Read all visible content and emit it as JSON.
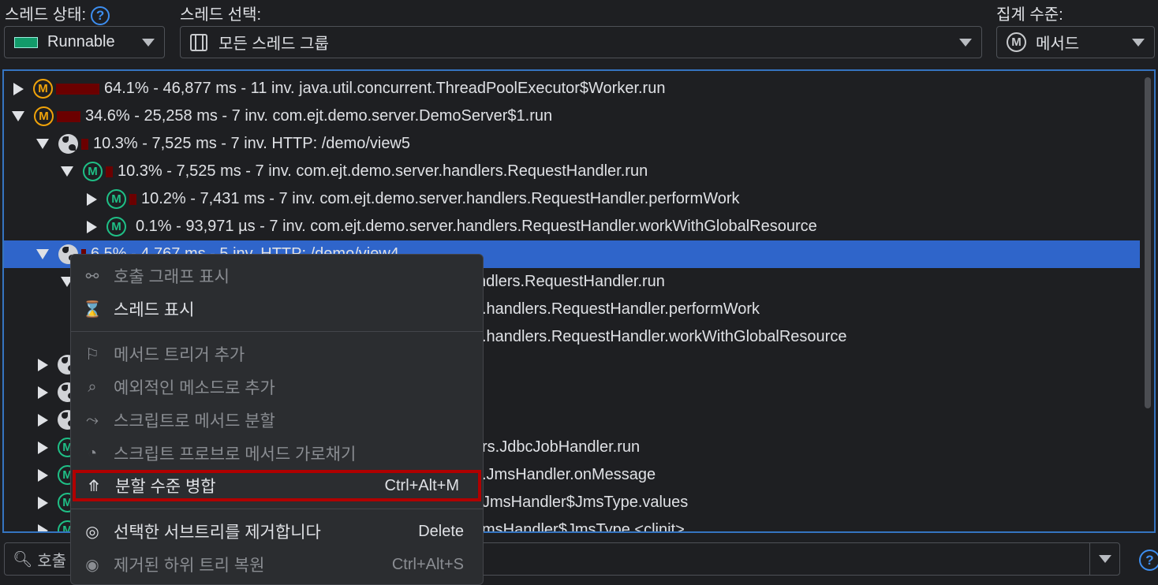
{
  "header": {
    "thread_state_label": "스레드 상태:",
    "thread_select_label": "스레드 선택:",
    "aggregation_label": "집계 수준:",
    "thread_state_value": "Runnable",
    "thread_state_color": "#129b6a",
    "thread_group_value": "모든 스레드 그룹",
    "aggregation_value": "메서드",
    "aggregation_icon": "M"
  },
  "tree": {
    "rows": [
      {
        "level": 0,
        "state": "collapsed",
        "icon": "method-orange",
        "bar_percent": 64.1,
        "text": "64.1% - 46,877 ms - 11 inv. java.util.concurrent.ThreadPoolExecutor$Worker.run"
      },
      {
        "level": 0,
        "state": "expanded",
        "icon": "method-orange",
        "bar_percent": 34.6,
        "text": "34.6% - 25,258 ms - 7 inv. com.ejt.demo.server.DemoServer$1.run"
      },
      {
        "level": 1,
        "state": "expanded",
        "icon": "globe",
        "bar_percent": 10.3,
        "text": "10.3% - 7,525 ms - 7 inv. HTTP: /demo/view5"
      },
      {
        "level": 2,
        "state": "expanded",
        "icon": "method-green",
        "bar_percent": 10.3,
        "text": "10.3% - 7,525 ms - 7 inv. com.ejt.demo.server.handlers.RequestHandler.run"
      },
      {
        "level": 3,
        "state": "collapsed",
        "icon": "method-green",
        "bar_percent": 10.2,
        "text": "10.2% - 7,431 ms - 7 inv. com.ejt.demo.server.handlers.RequestHandler.performWork"
      },
      {
        "level": 3,
        "state": "collapsed",
        "icon": "method-green",
        "bar_percent": 0.1,
        "text": "0.1% - 93,971 µs - 7 inv. com.ejt.demo.server.handlers.RequestHandler.workWithGlobalResource"
      },
      {
        "level": 1,
        "state": "expanded",
        "icon": "globe",
        "bar_percent": 6.5,
        "selected": true,
        "text": "6.5% - 4,767 ms - 5 inv. HTTP: /demo/view4"
      }
    ],
    "hidden_rows": [
      {
        "level": 2,
        "state": "expanded",
        "icon": "none",
        "fragment": "ndlers.RequestHandler.run"
      },
      {
        "level": 3,
        "state": "none",
        "icon": "none",
        "fragment": ".handlers.RequestHandler.performWork"
      },
      {
        "level": 3,
        "state": "none",
        "icon": "none",
        "fragment": ".handlers.RequestHandler.workWithGlobalResource"
      },
      {
        "level": 1,
        "state": "collapsed",
        "icon": "globe",
        "fragment": ""
      },
      {
        "level": 1,
        "state": "collapsed",
        "icon": "globe",
        "fragment": ""
      },
      {
        "level": 1,
        "state": "collapsed",
        "icon": "globe",
        "fragment": ""
      },
      {
        "level": 1,
        "state": "collapsed",
        "icon": "method-green",
        "fragment": "rs.JdbcJobHandler.run"
      },
      {
        "level": 1,
        "state": "collapsed",
        "icon": "method-green",
        "fragment": ".JmsHandler.onMessage"
      },
      {
        "level": 1,
        "state": "collapsed",
        "icon": "method-green",
        "fragment": "JmsHandler$JmsType.values"
      },
      {
        "level": 1,
        "state": "collapsed",
        "icon": "method-green",
        "fragment": "msHandler$JmsType.<clinit>"
      }
    ]
  },
  "search": {
    "value": "호출"
  },
  "context_menu": {
    "items": [
      {
        "label": "호출 그래프 표시",
        "icon": "call-graph-icon",
        "enabled": false
      },
      {
        "label": "스레드 표시",
        "icon": "thread-spool-icon",
        "enabled": true
      },
      {
        "label": "메서드 트리거 추가",
        "icon": "flag-icon",
        "enabled": false
      },
      {
        "label": "예외적인 메소드로 추가",
        "icon": "focus-search-icon",
        "enabled": false
      },
      {
        "label": "스크립트로 메서드 분할",
        "icon": "split-arrow-icon",
        "enabled": false
      },
      {
        "label": "스크립트 프로브로 메서드 가로채기",
        "icon": "gauge-icon",
        "enabled": false
      },
      {
        "label": "분할 수준 병합",
        "icon": "merge-icon",
        "enabled": true,
        "shortcut": "Ctrl+Alt+M",
        "highlighted": true
      },
      {
        "label": "선택한 서브트리를 제거합니다",
        "icon": "eye-slash-icon",
        "enabled": true,
        "shortcut": "Delete"
      },
      {
        "label": "제거된 하위 트리 복원",
        "icon": "eye-icon",
        "enabled": false,
        "shortcut": "Ctrl+Alt+S"
      }
    ],
    "highlight_color": "#b00000"
  },
  "colors": {
    "selection": "#2f65ca",
    "bar": "#6b0000",
    "accent": "#3574c0"
  }
}
